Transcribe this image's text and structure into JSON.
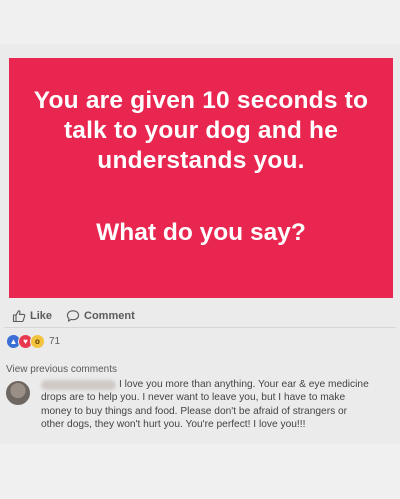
{
  "post": {
    "card_color": "#e8264f",
    "headline_lines": [
      "You are given 10 seconds to",
      "talk to your dog and he",
      "understands you."
    ],
    "question": "What do you say?"
  },
  "actions": {
    "like_label": "Like",
    "like_icon": "thumbs-up-icon",
    "comment_label": "Comment",
    "comment_icon": "speech-bubble-icon"
  },
  "reactions": {
    "icons": [
      "like-reaction-icon",
      "love-reaction-icon",
      "wow-reaction-icon"
    ],
    "count": "71"
  },
  "comments": {
    "view_previous": "View previous comments",
    "items": [
      {
        "text": "I love you more than anything. Your ear & eye medicine drops are to help you. I never want to leave you, but I have to make money to buy things and food. Please don't be afraid of strangers or other dogs, they won't hurt you. You're perfect! I love you!!!"
      }
    ]
  }
}
